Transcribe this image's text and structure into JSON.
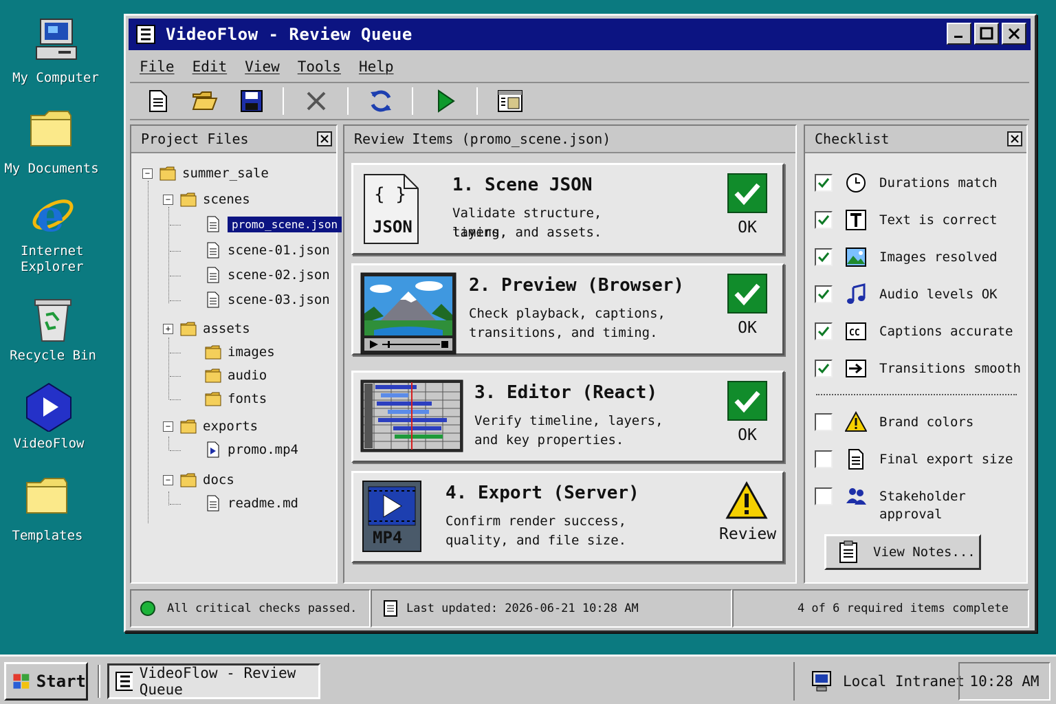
{
  "desktop": {
    "icons": [
      {
        "label": "My Computer",
        "icon": "computer-icon"
      },
      {
        "label": "My Documents",
        "icon": "folder-icon"
      },
      {
        "label": "Internet Explorer",
        "icon": "internet-explorer-icon"
      },
      {
        "label": "Recycle Bin",
        "icon": "recycle-bin-icon"
      },
      {
        "label": "VideoFlow",
        "icon": "videoflow-icon"
      },
      {
        "label": "Templates",
        "icon": "folder-icon"
      }
    ]
  },
  "window": {
    "title": "VideoFlow - Review Queue",
    "menu": [
      "File",
      "Edit",
      "View",
      "Tools",
      "Help"
    ],
    "toolbar": [
      "new-file-icon",
      "open-folder-icon",
      "save-icon",
      "delete-icon",
      "refresh-icon",
      "play-icon",
      "panel-layout-icon"
    ]
  },
  "project_files": {
    "title": "Project Files",
    "tree": [
      {
        "label": "summer_sale",
        "type": "folder",
        "expanded": true
      },
      {
        "label": "scenes",
        "type": "folder",
        "expanded": true
      },
      {
        "label": "promo_scene.json",
        "type": "file",
        "selected": true
      },
      {
        "label": "scene-01.json",
        "type": "file"
      },
      {
        "label": "scene-02.json",
        "type": "file"
      },
      {
        "label": "scene-03.json",
        "type": "file"
      },
      {
        "label": "assets",
        "type": "folder",
        "expanded": false
      },
      {
        "label": "images",
        "type": "folder"
      },
      {
        "label": "audio",
        "type": "folder"
      },
      {
        "label": "fonts",
        "type": "folder"
      },
      {
        "label": "exports",
        "type": "folder",
        "expanded": true
      },
      {
        "label": "promo.mp4",
        "type": "video"
      },
      {
        "label": "docs",
        "type": "folder",
        "expanded": true
      },
      {
        "label": "readme.md",
        "type": "file"
      }
    ]
  },
  "review": {
    "title": "Review Items (promo_scene.json)",
    "items": [
      {
        "title": "1. Scene JSON",
        "desc1": "Validate structure, timing,",
        "desc2": "layers, and assets.",
        "status": "OK",
        "thumb_label": "JSON",
        "thumb_braces": "{  }"
      },
      {
        "title": "2. Preview (Browser)",
        "desc1": "Check playback, captions,",
        "desc2": "transitions, and timing.",
        "status": "OK"
      },
      {
        "title": "3. Editor (React)",
        "desc1": "Verify timeline, layers,",
        "desc2": "and key properties.",
        "status": "OK"
      },
      {
        "title": "4. Export (Server)",
        "desc1": "Confirm render success,",
        "desc2": "quality, and file size.",
        "status": "Review",
        "thumb_label": "MP4"
      }
    ]
  },
  "checklist": {
    "title": "Checklist",
    "items": [
      {
        "label": "Durations match",
        "checked": true,
        "icon": "clock-icon"
      },
      {
        "label": "Text is correct",
        "checked": true,
        "icon": "text-icon"
      },
      {
        "label": "Images resolved",
        "checked": true,
        "icon": "image-icon"
      },
      {
        "label": "Audio levels OK",
        "checked": true,
        "icon": "music-note-icon"
      },
      {
        "label": "Captions accurate",
        "checked": true,
        "icon": "captions-icon"
      },
      {
        "label": "Transitions smooth",
        "checked": true,
        "icon": "transition-icon"
      },
      {
        "label": "Brand colors",
        "checked": false,
        "icon": "warning-icon"
      },
      {
        "label": "Final export size",
        "checked": false,
        "icon": "document-icon"
      },
      {
        "label": "Stakeholder approval",
        "checked": false,
        "icon": "users-icon"
      }
    ],
    "notes_button": "View Notes..."
  },
  "statusbar": {
    "message": "All critical checks passed.",
    "updated": "Last updated: 2026-06-21  10:28 AM",
    "progress": "4 of 6 required items complete"
  },
  "taskbar": {
    "start": "Start",
    "task": "VideoFlow - Review Queue",
    "zone": "Local Intranet",
    "clock": "10:28 AM"
  },
  "colors": {
    "titlebar": "#0c1482",
    "desktop": "#0b7a80",
    "ok_green": "#118c2b",
    "warning_yellow": "#f5d000"
  }
}
